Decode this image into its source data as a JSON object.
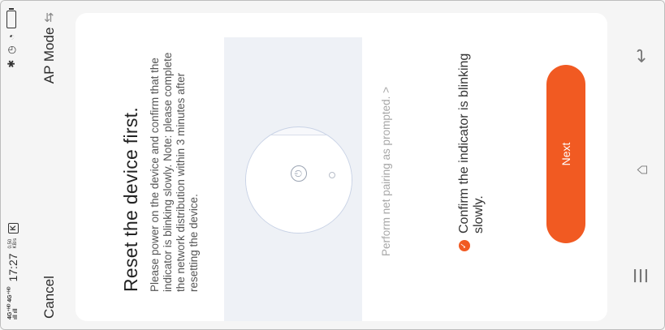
{
  "status_bar": {
    "signal_top": "4G⁺ᴴᴰ 4G⁺ᴴᴰ",
    "signal_bars": "ıll ıll",
    "time": "17:27",
    "rate_value": "0.50",
    "rate_unit": "KB/s",
    "k_badge": "K",
    "icons": [
      "bluetooth-icon",
      "alarm-icon",
      "wifi-icon",
      "battery-icon"
    ]
  },
  "header": {
    "cancel_label": "Cancel",
    "mode_label": "AP Mode",
    "mode_icon": "swap-icon"
  },
  "card": {
    "title": "Reset the device first.",
    "description": "Please power on the device and confirm that the indicator is blinking slowly. Note: please complete the network distribution within 3 minutes after resetting the device.",
    "hint_link": "Perform net pairing as prompted. >",
    "confirm_text": "Confirm the indicator is blinking slowly.",
    "next_label": "Next"
  },
  "nav_bar": {
    "icons": [
      "menu-icon",
      "home-icon",
      "back-icon"
    ]
  },
  "colors": {
    "accent": "#f15a22",
    "card_bg": "#ffffff",
    "page_bg": "#f5f5f5"
  }
}
